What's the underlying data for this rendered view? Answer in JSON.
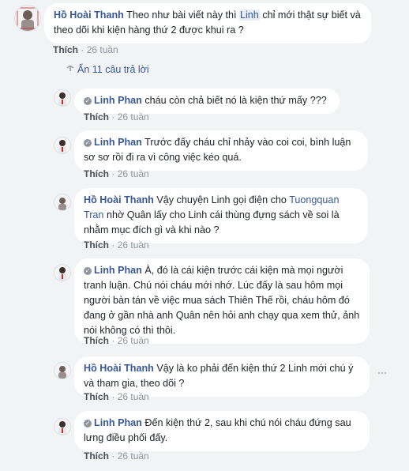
{
  "top_comment": {
    "name": "Hồ Hoài Thanh",
    "text_before": "Theo như bài viết này thì",
    "tag": "Linh",
    "text_after": "chỉ mới thật sự biết và theo dõi khi kiện hàng thứ 2 được khui ra ?",
    "like_label": "Thích",
    "sep": "·",
    "time": "26 tuần"
  },
  "replies_toggle": {
    "label": "Ẩn 11 câu trả lời"
  },
  "replies": [
    {
      "name": "Linh Phan",
      "text": "cháu còn chả biết nó là kiện thứ mấy ???",
      "like_label": "Thích",
      "sep": "·",
      "time": "26 tuần"
    },
    {
      "name": "Linh Phan",
      "text": "Trước đấy cháu chỉ nhảy vào coi coi, bình luận sơ sơ rồi đi ra vì công việc kéo quá.",
      "like_label": "Thích",
      "sep": "·",
      "time": "26 tuần"
    },
    {
      "name": "Hồ Hoài Thanh",
      "text_before": "Vậy chuyện Linh gọi điện cho",
      "link": "Tuongquan Tran",
      "text_after": "nhờ Quân lấy cho Linh cái thùng đựng sách về soi là nhằm mục đích gì và khi nào ?",
      "like_label": "Thích",
      "sep": "·",
      "time": "26 tuần"
    },
    {
      "name": "Linh Phan",
      "text": "À, đó là cái kiện trước cái kiện mà mọi người tranh luận. Chú nói cháu mới nhớ. Lúc đấy là sau hôm mọi người bàn tán về việc mua sách Thiên Thế rồi, cháu hôm đó đang ở gần nhà anh Quân nên hỏi anh chạy qua xem thử, ảnh nói không có thì thôi.",
      "like_label": "Thích",
      "sep": "·",
      "time": "26 tuần"
    },
    {
      "name": "Hồ Hoài Thanh",
      "text": "Vậy là ko phải đến kiện thứ 2 Linh mới chú ý và tham gia, theo dõi ?",
      "like_label": "Thích",
      "sep": "·",
      "time": "26 tuần"
    },
    {
      "name": "Linh Phan",
      "text": "Đến kiện thứ 2, sau khi chú nói cháu đứng sau lưng điều phối đấy.",
      "like_label": "Thích",
      "sep": "·",
      "time": "26 tuần"
    }
  ]
}
